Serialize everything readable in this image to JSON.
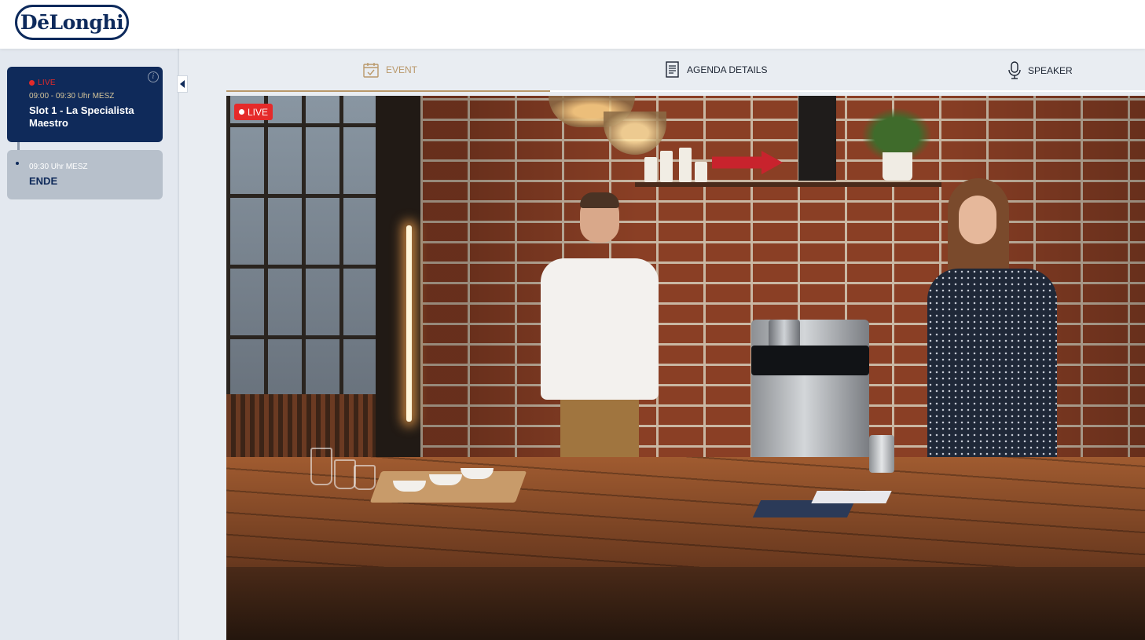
{
  "header": {
    "logo_text": "DēLonghi"
  },
  "sidebar": {
    "slots": [
      {
        "live_label": "LIVE",
        "time": "09:00 - 09:30 Uhr MESZ",
        "title": "Slot 1 - La Specialista Maestro"
      },
      {
        "time": "09:30 Uhr MESZ",
        "title": "ENDE"
      }
    ]
  },
  "tabs": [
    {
      "label": "EVENT",
      "icon": "calendar-check-icon",
      "active": true
    },
    {
      "label": "AGENDA DETAILS",
      "icon": "document-icon",
      "active": false
    },
    {
      "label": "SPEAKER",
      "icon": "microphone-icon",
      "active": false
    }
  ],
  "video": {
    "live_label": "LIVE"
  },
  "colors": {
    "navy": "#0f2a5a",
    "gold": "#b9986a",
    "live_red": "#e52a2a",
    "sidebar_bg": "#e3e8ef"
  }
}
